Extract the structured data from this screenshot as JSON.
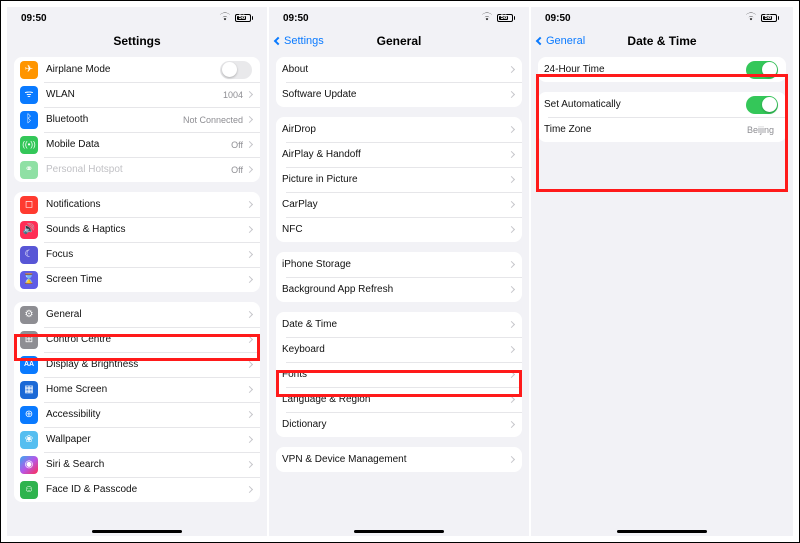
{
  "status": {
    "time": "09:50",
    "battery": "58"
  },
  "screen1": {
    "title": "Settings",
    "group1": [
      {
        "icon": "airplane-icon",
        "color": "c-orange",
        "label": "Airplane Mode",
        "widget": "switch-off"
      },
      {
        "icon": "wifi-icon",
        "color": "c-blue",
        "label": "WLAN",
        "detail": "1004",
        "widget": "disclosure"
      },
      {
        "icon": "bluetooth-icon",
        "color": "c-blue",
        "label": "Bluetooth",
        "detail": "Not Connected",
        "widget": "disclosure"
      },
      {
        "icon": "mobiledata-icon",
        "color": "c-teal",
        "label": "Mobile Data",
        "detail": "Off",
        "widget": "disclosure"
      },
      {
        "icon": "hotspot-icon",
        "color": "c-teal",
        "label": "Personal Hotspot",
        "detail": "Off",
        "widget": "disclosure",
        "disabled": true
      }
    ],
    "group2": [
      {
        "icon": "notifications-icon",
        "color": "c-red",
        "label": "Notifications"
      },
      {
        "icon": "sounds-icon",
        "color": "c-pink",
        "label": "Sounds & Haptics"
      },
      {
        "icon": "focus-icon",
        "color": "c-purple",
        "label": "Focus"
      },
      {
        "icon": "screentime-icon",
        "color": "c-indigo",
        "label": "Screen Time"
      }
    ],
    "group3": [
      {
        "icon": "general-icon",
        "color": "c-gray",
        "label": "General",
        "highlight": true
      },
      {
        "icon": "controlcentre-icon",
        "color": "c-gray",
        "label": "Control Centre"
      },
      {
        "icon": "display-icon",
        "color": "c-blue",
        "label": "Display & Brightness"
      },
      {
        "icon": "homescreen-icon",
        "color": "c-dblue",
        "label": "Home Screen"
      },
      {
        "icon": "accessibility-icon",
        "color": "c-blue",
        "label": "Accessibility"
      },
      {
        "icon": "wallpaper-icon",
        "color": "c-cyan",
        "label": "Wallpaper"
      },
      {
        "icon": "siri-icon",
        "color": "c-plum",
        "label": "Siri & Search"
      },
      {
        "icon": "faceid-icon",
        "color": "c-dgreen",
        "label": "Face ID & Passcode"
      }
    ]
  },
  "screen2": {
    "back": "Settings",
    "title": "General",
    "group1": [
      {
        "label": "About"
      },
      {
        "label": "Software Update"
      }
    ],
    "group2": [
      {
        "label": "AirDrop"
      },
      {
        "label": "AirPlay & Handoff"
      },
      {
        "label": "Picture in Picture"
      },
      {
        "label": "CarPlay"
      },
      {
        "label": "NFC"
      }
    ],
    "group3": [
      {
        "label": "iPhone Storage"
      },
      {
        "label": "Background App Refresh"
      }
    ],
    "group4": [
      {
        "label": "Date & Time",
        "highlight": true
      },
      {
        "label": "Keyboard"
      },
      {
        "label": "Fonts"
      },
      {
        "label": "Language & Region"
      },
      {
        "label": "Dictionary"
      }
    ],
    "group5": [
      {
        "label": "VPN & Device Management"
      }
    ]
  },
  "screen3": {
    "back": "General",
    "title": "Date & Time",
    "group1": [
      {
        "label": "24-Hour Time",
        "switch": true
      }
    ],
    "group2": [
      {
        "label": "Set Automatically",
        "switch": true
      },
      {
        "label": "Time Zone",
        "detail": "Beijing"
      }
    ]
  }
}
